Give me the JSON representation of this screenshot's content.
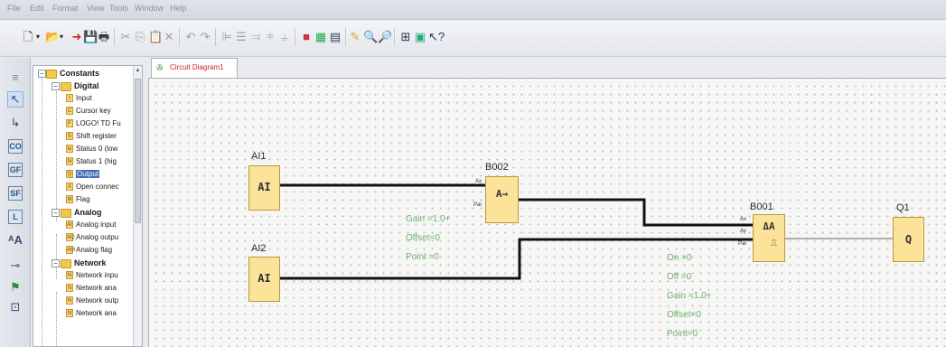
{
  "menu": [
    "File",
    "Edit",
    "Format",
    "View",
    "Tools",
    "Window",
    "Help"
  ],
  "tree": {
    "rows": [
      {
        "label": "Constants",
        "level": 0,
        "type": "folder",
        "bold": true
      },
      {
        "label": "Digital",
        "level": 1,
        "type": "folder",
        "bold": true
      },
      {
        "label": "Input",
        "level": 2,
        "type": "item"
      },
      {
        "label": "Cursor key",
        "level": 2,
        "type": "item"
      },
      {
        "label": "LOGO! TD Fu",
        "level": 2,
        "type": "item"
      },
      {
        "label": "Shift register",
        "level": 2,
        "type": "item"
      },
      {
        "label": "Status 0 (low",
        "level": 2,
        "type": "item"
      },
      {
        "label": "Status 1 (hig",
        "level": 2,
        "type": "item"
      },
      {
        "label": "Output",
        "level": 2,
        "type": "item",
        "selected": true
      },
      {
        "label": "Open connec",
        "level": 2,
        "type": "item"
      },
      {
        "label": "Flag",
        "level": 2,
        "type": "item"
      },
      {
        "label": "Analog",
        "level": 1,
        "type": "folder",
        "bold": true
      },
      {
        "label": "Analog input",
        "level": 2,
        "type": "item"
      },
      {
        "label": "Analog outpu",
        "level": 2,
        "type": "item"
      },
      {
        "label": "Analog flag",
        "level": 2,
        "type": "item"
      },
      {
        "label": "Network",
        "level": 1,
        "type": "folder",
        "bold": true
      },
      {
        "label": "Network inpu",
        "level": 2,
        "type": "item"
      },
      {
        "label": "Network ana",
        "level": 2,
        "type": "item"
      },
      {
        "label": "Network outp",
        "level": 2,
        "type": "item"
      },
      {
        "label": "Network ana",
        "level": 2,
        "type": "item"
      }
    ]
  },
  "tab": {
    "label": "Circuit Diagram1"
  },
  "diagram": {
    "blocks": {
      "ai1": {
        "label": "AI1",
        "text": "AI"
      },
      "ai2": {
        "label": "AI2",
        "text": "AI"
      },
      "b002": {
        "label": "B002",
        "text": "A→",
        "pin_in": "Ax",
        "pin_par": "Par"
      },
      "b001": {
        "label": "B001",
        "text": "ΔA",
        "pin_ax": "Ax",
        "pin_ay": "Ay",
        "pin_par": "Par"
      },
      "q1": {
        "label": "Q1",
        "text": "Q"
      }
    },
    "b002_params": [
      "Gain  =1.0+",
      "Offset=0",
      "Point =0"
    ],
    "b001_params": [
      "On    =0",
      "Off   =0",
      "Gain  =1.0+",
      "Offset=0",
      "Point=0"
    ]
  },
  "colors": {
    "block_fill": "#fbe39a",
    "param_text": "#6fb36f",
    "wire": "#111111"
  }
}
